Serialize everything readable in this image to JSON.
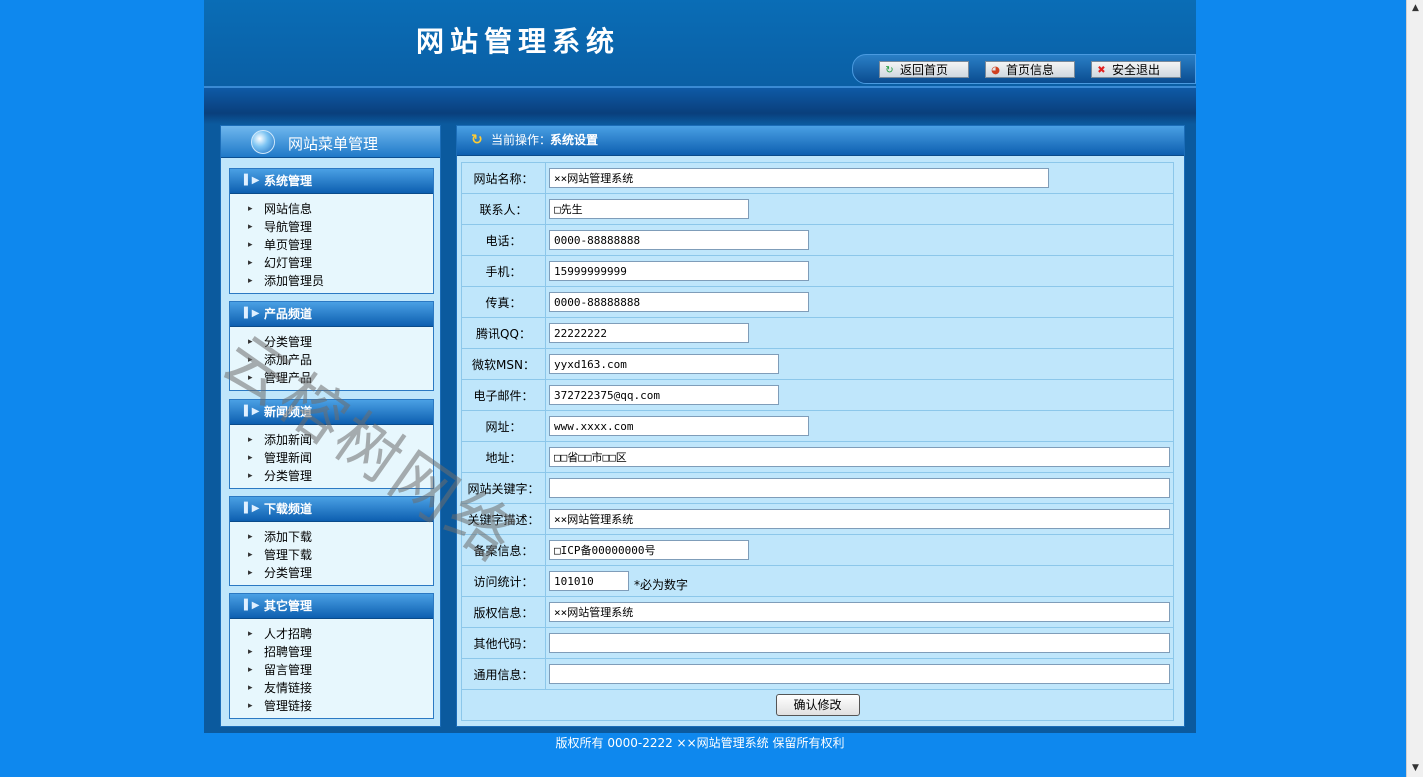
{
  "header": {
    "title": "网站管理系统",
    "nav": [
      {
        "label": "返回首页",
        "icon": "refresh-icon",
        "color": "#1a9a3a"
      },
      {
        "label": "首页信息",
        "icon": "pie-chart-icon",
        "color": "#d04020"
      },
      {
        "label": "安全退出",
        "icon": "close-icon",
        "color": "#e02020"
      }
    ]
  },
  "sidebar": {
    "title": "网站菜单管理",
    "groups": [
      {
        "title": "系统管理",
        "items": [
          "网站信息",
          "导航管理",
          "单页管理",
          "幻灯管理",
          "添加管理员"
        ]
      },
      {
        "title": "产品频道",
        "items": [
          "分类管理",
          "添加产品",
          "管理产品"
        ]
      },
      {
        "title": "新闻频道",
        "items": [
          "添加新闻",
          "管理新闻",
          "分类管理"
        ]
      },
      {
        "title": "下载频道",
        "items": [
          "添加下载",
          "管理下载",
          "分类管理"
        ]
      },
      {
        "title": "其它管理",
        "items": [
          "人才招聘",
          "招聘管理",
          "留言管理",
          "友情链接",
          "管理链接"
        ]
      }
    ]
  },
  "main": {
    "operation_label": "当前操作：",
    "operation_value": "系统设置",
    "fields": [
      {
        "label": "网站名称：",
        "value": "××网站管理系统"
      },
      {
        "label": "联系人：",
        "value": "□先生"
      },
      {
        "label": "电话：",
        "value": "0000-88888888"
      },
      {
        "label": "手机：",
        "value": "15999999999"
      },
      {
        "label": "传真：",
        "value": "0000-88888888"
      },
      {
        "label": "腾讯QQ：",
        "value": "22222222"
      },
      {
        "label": "微软MSN：",
        "value": "yyxd163.com"
      },
      {
        "label": "电子邮件：",
        "value": "372722375@qq.com"
      },
      {
        "label": "网址：",
        "value": "www.xxxx.com"
      },
      {
        "label": "地址：",
        "value": "□□省□□市□□区"
      },
      {
        "label": "网站关键字：",
        "value": ""
      },
      {
        "label": "关键字描述：",
        "value": "××网站管理系统"
      },
      {
        "label": "备案信息：",
        "value": "□ICP备00000000号"
      },
      {
        "label": "访问统计：",
        "value": "101010",
        "note": "*必为数字"
      },
      {
        "label": "版权信息：",
        "value": "××网站管理系统"
      },
      {
        "label": "其他代码：",
        "value": ""
      },
      {
        "label": "通用信息：",
        "value": ""
      }
    ],
    "submit_label": "确认修改"
  },
  "footer": {
    "text": "版权所有 0000-2222 ××网站管理系统 保留所有权利"
  },
  "watermark": "云榕树网络"
}
